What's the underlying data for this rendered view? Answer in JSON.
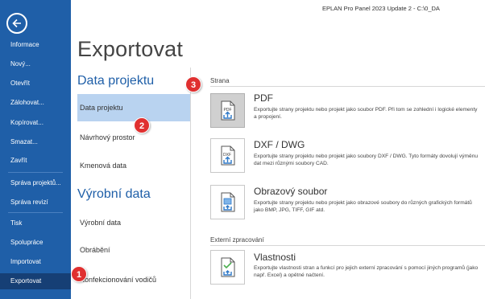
{
  "titlebar": {
    "text": "EPLAN Pro Panel 2023 Update 2 - C:\\0_DA"
  },
  "sidebar": {
    "items": [
      {
        "label": "Informace"
      },
      {
        "label": "Nový..."
      },
      {
        "label": "Otevřít"
      },
      {
        "label": "Zálohovat..."
      },
      {
        "label": "Kopírovat..."
      },
      {
        "label": "Smazat..."
      },
      {
        "label": "Zavřít"
      },
      {
        "label": "Správa projektů..."
      },
      {
        "label": "Správa revizí"
      },
      {
        "label": "Tisk"
      },
      {
        "label": "Spolupráce"
      },
      {
        "label": "Importovat"
      },
      {
        "label": "Exportovat"
      }
    ],
    "active_index": 12
  },
  "page": {
    "title": "Exportovat"
  },
  "middle": {
    "section1": "Data projektu",
    "items1": [
      "Data projektu",
      "Návrhový prostor",
      "Kmenová data"
    ],
    "section2": "Výrobní data",
    "items2": [
      "Výrobní data",
      "Obrábění",
      "Konfekcionování vodičů"
    ]
  },
  "right": {
    "group1": "Strana",
    "group2": "Externí zpracování",
    "options": [
      {
        "title": "PDF",
        "desc": "Exportujte strany projektu nebo projekt jako soubor PDF. Při tom se zohlední i logické elementy a propojení.",
        "icon": "pdf-export-icon"
      },
      {
        "title": "DXF / DWG",
        "desc": "Exportujte strany projektu nebo projekt jako soubory DXF / DWG. Tyto formáty dovolují výměnu dat mezi různými soubory CAD.",
        "icon": "dxf-export-icon"
      },
      {
        "title": "Obrazový soubor",
        "desc": "Exportujte strany projektu nebo projekt jako obrazové soubory do různých grafických formátů jako BMP, JPG, TIFF, GIF atd.",
        "icon": "image-export-icon"
      },
      {
        "title": "Vlastnosti",
        "desc": "Exportujte vlastnosti stran a funkcí pro jejich externí zpracování s pomocí jiných programů (jako např. Excel) a opětné načtení.",
        "icon": "properties-export-icon"
      }
    ]
  },
  "callouts": [
    "1",
    "2",
    "3"
  ],
  "colors": {
    "sidebar": "#1f5fa8",
    "sidebar_active": "#163f75",
    "selected": "#b9d3f0",
    "accent": "#1f5fa8",
    "callout": "#e03030"
  }
}
